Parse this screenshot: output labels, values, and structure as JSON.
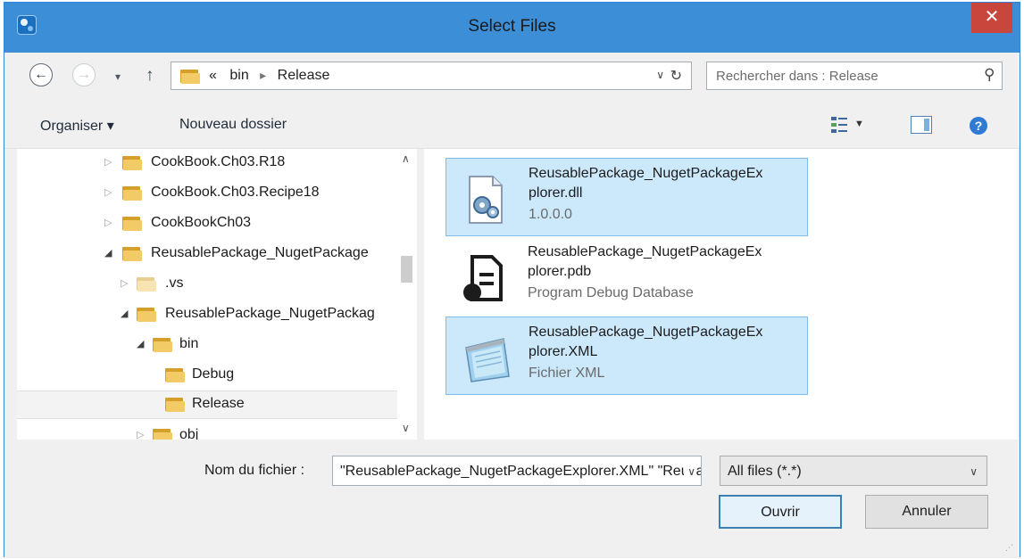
{
  "window": {
    "title": "Select Files",
    "close_label": "✕"
  },
  "nav": {
    "back_glyph": "←",
    "forward_glyph": "→",
    "recent_glyph": "▾",
    "up_glyph": "↑",
    "breadcrumb": {
      "overflow": "«",
      "segments": [
        "bin",
        "Release"
      ],
      "separator": "▸"
    },
    "addr_dropdown_glyph": "∨",
    "refresh_glyph": "↻",
    "search_placeholder": "Rechercher dans : Release",
    "search_glyph": "⚲"
  },
  "toolbar": {
    "organize_label": "Organiser ▾",
    "new_folder_label": "Nouveau dossier",
    "view_dropdown_glyph": "▼",
    "help_glyph": "?"
  },
  "tree": {
    "items": [
      {
        "label": "CookBook.Ch03.R18",
        "expanded": false
      },
      {
        "label": "CookBook.Ch03.Recipe18",
        "expanded": false
      },
      {
        "label": "CookBookCh03",
        "expanded": false
      },
      {
        "label": "ReusablePackage_NugetPackage",
        "expanded": true
      },
      {
        "label": ".vs",
        "expanded": false
      },
      {
        "label": "ReusablePackage_NugetPackag",
        "expanded": true
      },
      {
        "label": "bin",
        "expanded": true
      },
      {
        "label": "Debug",
        "expanded": null
      },
      {
        "label": "Release",
        "expanded": null,
        "selected": true
      },
      {
        "label": "obj",
        "expanded": false
      }
    ],
    "arrow_open": "◢",
    "arrow_closed": "▷"
  },
  "scroll": {
    "up_glyph": "∧",
    "down_glyph": "∨"
  },
  "files": [
    {
      "name_line1": "ReusablePackage_NugetPackageEx",
      "name_line2": "plorer.dll",
      "desc": "1.0.0.0",
      "icon": "dll-gear-icon",
      "selected": true
    },
    {
      "name_line1": "ReusablePackage_NugetPackageEx",
      "name_line2": "plorer.pdb",
      "desc": "Program Debug Database",
      "icon": "pdb-document-icon",
      "selected": false
    },
    {
      "name_line1": "ReusablePackage_NugetPackageEx",
      "name_line2": "plorer.XML",
      "desc": "Fichier XML",
      "icon": "xml-notepad-icon",
      "selected": true
    }
  ],
  "bottom": {
    "filename_label": "Nom du fichier :",
    "filename_value": "\"ReusablePackage_NugetPackageExplorer.XML\" \"ReusablePackage_NugetPackageExplorer.dll\"",
    "filename_dd_glyph": "∨",
    "filter_value": "All files (*.*)",
    "filter_dd_glyph": "∨",
    "open_label": "Ouvrir",
    "cancel_label": "Annuler",
    "grip_glyph": "⋰"
  },
  "colors": {
    "titlebar": "#3c8fd6",
    "close": "#c9463d",
    "selection": "#cce8fb",
    "selection_border": "#7ebeef",
    "folder": "#f2cb67"
  }
}
